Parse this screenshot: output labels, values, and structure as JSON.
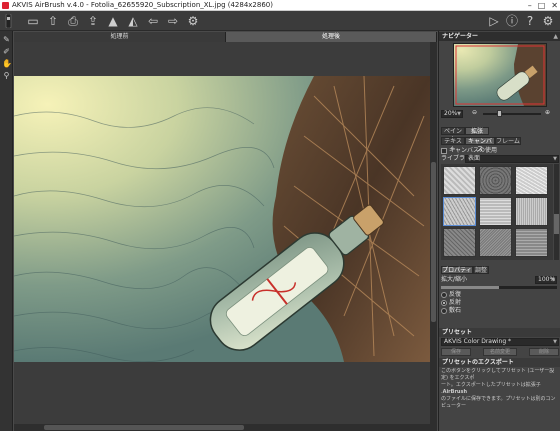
{
  "window": {
    "title": "AKVIS AirBrush v.4.0 - Fotolia_62655920_Subscription_XL.jpg (4284x2860)"
  },
  "view_tabs": [
    "処理前",
    "処理後"
  ],
  "navigator": {
    "title": "ナビゲーター",
    "zoom": "20%"
  },
  "main_tabs": [
    "ペイント",
    "拡张"
  ],
  "sub_tabs": [
    "テキスト",
    "キャンバス",
    "フレーム"
  ],
  "canvas_settings": {
    "use_canvas_label": "キャンバスの使用",
    "library_label": "ライブラリー",
    "library_value": "表面",
    "bottom_tabs": [
      "プロパティ",
      "調整"
    ],
    "scale_label": "拡大/縮小",
    "scale_value": "100%",
    "placement_options": [
      "反復",
      "反射",
      "敷石"
    ],
    "placement_selected": 1
  },
  "preset": {
    "title": "プリセット",
    "value": "AKVIS Color Drawing *",
    "buttons": [
      "保存",
      "名前変更",
      "削除"
    ]
  },
  "export": {
    "title": "プリセットのエクスポート",
    "text_line1": "このボタンをクリックしてプリセット (ユーザー設定) をエクスポ",
    "text_line2": "ート。エクスポートしたプリセットは拡張子 .",
    "brand": "AirBrush",
    "text_line3": "のファイルに保存できます。プリセットは別のコンピューター"
  },
  "colors": {
    "accent": "#5b8dd6",
    "ribbon": "#c8302a"
  }
}
